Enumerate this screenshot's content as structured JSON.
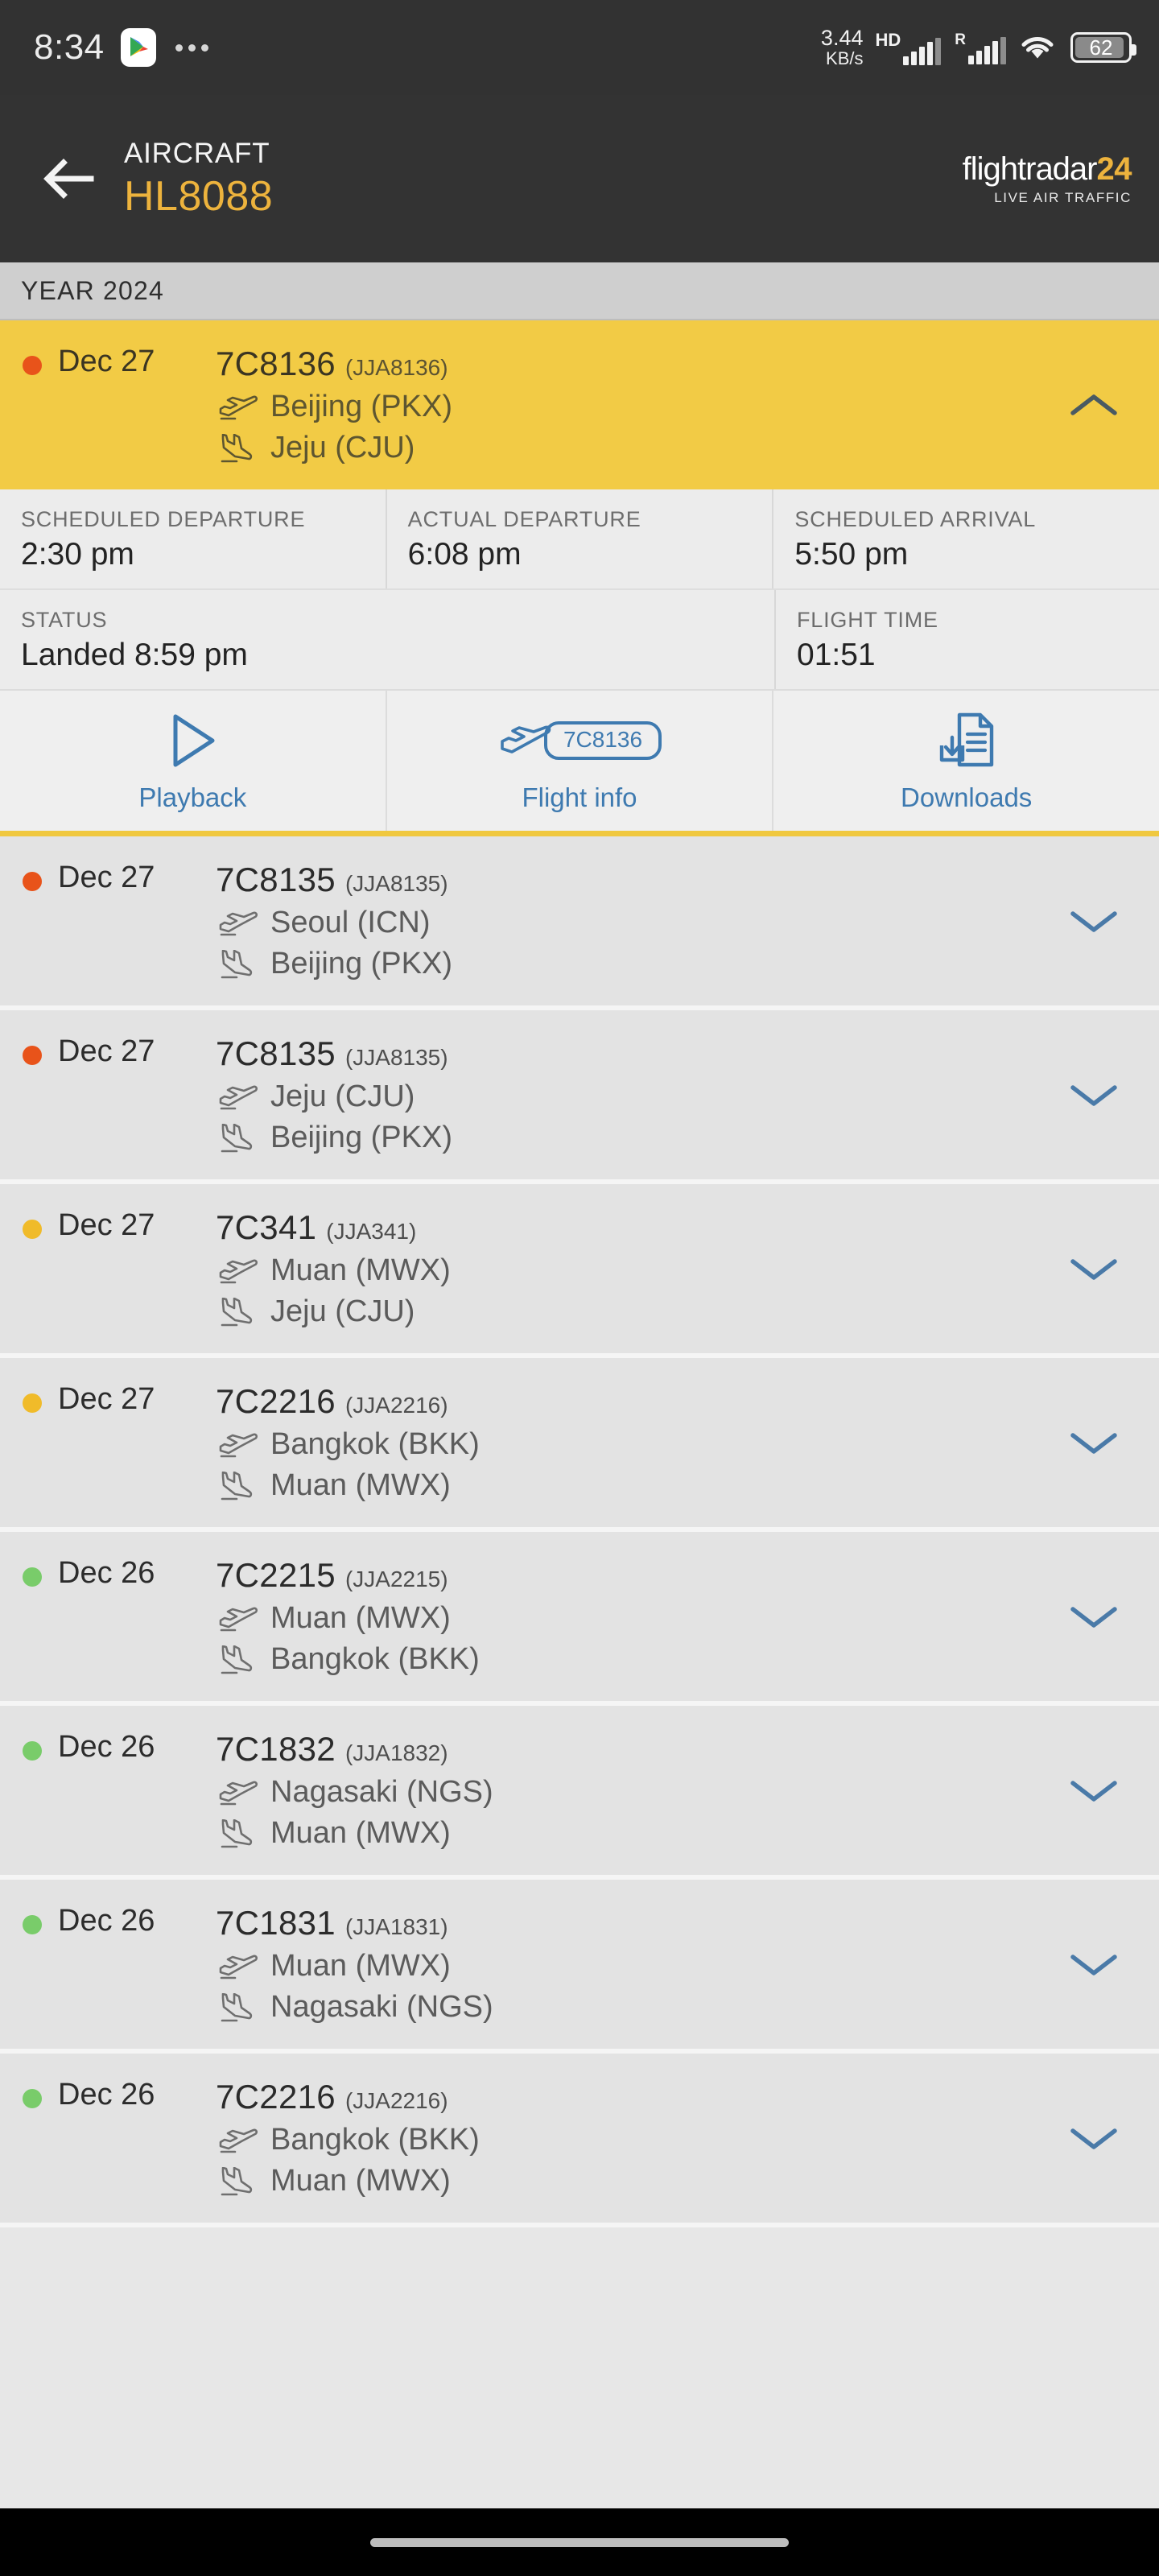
{
  "status_bar": {
    "time": "8:34",
    "play_store_icon": "play-store-icon",
    "overflow_icon": "more-dots-icon",
    "net_speed_value": "3.44",
    "net_speed_unit": "KB/s",
    "hd_label": "HD",
    "roaming_label": "R",
    "wifi_icon": "wifi-icon",
    "battery_level": "62"
  },
  "header": {
    "back_icon": "back-arrow-icon",
    "subtitle": "AIRCRAFT",
    "title": "HL8088",
    "brand_primary": "flightradar",
    "brand_accent": "24",
    "brand_tagline": "LIVE AIR TRAFFIC",
    "accent_color": "#edb33d"
  },
  "year_bar": {
    "label": "YEAR 2024"
  },
  "expanded_flight": {
    "dot_color": "#e8531a",
    "date": "Dec 27",
    "flight_number": "7C8136",
    "alt_number": "(JJA8136)",
    "origin": "Beijing (PKX)",
    "destination": "Jeju (CJU)",
    "collapse_icon": "chevron-up-icon",
    "details": [
      {
        "label": "SCHEDULED DEPARTURE",
        "value": "2:30 pm"
      },
      {
        "label": "ACTUAL DEPARTURE",
        "value": "6:08 pm"
      },
      {
        "label": "SCHEDULED ARRIVAL",
        "value": "5:50 pm"
      }
    ],
    "status_label": "STATUS",
    "status_value": "Landed 8:59 pm",
    "flight_time_label": "FLIGHT TIME",
    "flight_time_value": "01:51",
    "actions": [
      {
        "label": "Playback",
        "icon": "play-triangle-icon"
      },
      {
        "label": "Flight info",
        "icon": "airplane-tag-icon",
        "pill_text": "7C8136"
      },
      {
        "label": "Downloads",
        "icon": "document-download-icon"
      }
    ]
  },
  "flights": [
    {
      "dot_color": "#e8531a",
      "date": "Dec 27",
      "flight_number": "7C8135",
      "alt_number": "(JJA8135)",
      "origin": "Seoul (ICN)",
      "destination": "Beijing (PKX)",
      "expand_icon": "chevron-down-icon"
    },
    {
      "dot_color": "#e8531a",
      "date": "Dec 27",
      "flight_number": "7C8135",
      "alt_number": "(JJA8135)",
      "origin": "Jeju (CJU)",
      "destination": "Beijing (PKX)",
      "expand_icon": "chevron-down-icon"
    },
    {
      "dot_color": "#f0bb2a",
      "date": "Dec 27",
      "flight_number": "7C341",
      "alt_number": "(JJA341)",
      "origin": "Muan (MWX)",
      "destination": "Jeju (CJU)",
      "expand_icon": "chevron-down-icon"
    },
    {
      "dot_color": "#f0bb2a",
      "date": "Dec 27",
      "flight_number": "7C2216",
      "alt_number": "(JJA2216)",
      "origin": "Bangkok (BKK)",
      "destination": "Muan (MWX)",
      "expand_icon": "chevron-down-icon"
    },
    {
      "dot_color": "#79cc6a",
      "date": "Dec 26",
      "flight_number": "7C2215",
      "alt_number": "(JJA2215)",
      "origin": "Muan (MWX)",
      "destination": "Bangkok (BKK)",
      "expand_icon": "chevron-down-icon"
    },
    {
      "dot_color": "#79cc6a",
      "date": "Dec 26",
      "flight_number": "7C1832",
      "alt_number": "(JJA1832)",
      "origin": "Nagasaki (NGS)",
      "destination": "Muan (MWX)",
      "expand_icon": "chevron-down-icon"
    },
    {
      "dot_color": "#79cc6a",
      "date": "Dec 26",
      "flight_number": "7C1831",
      "alt_number": "(JJA1831)",
      "origin": "Muan (MWX)",
      "destination": "Nagasaki (NGS)",
      "expand_icon": "chevron-down-icon"
    },
    {
      "dot_color": "#79cc6a",
      "date": "Dec 26",
      "flight_number": "7C2216",
      "alt_number": "(JJA2216)",
      "origin": "Bangkok (BKK)",
      "destination": "Muan (MWX)",
      "expand_icon": "chevron-down-icon"
    }
  ],
  "nav_bar": {
    "home_indicator": "home-pill-indicator"
  }
}
